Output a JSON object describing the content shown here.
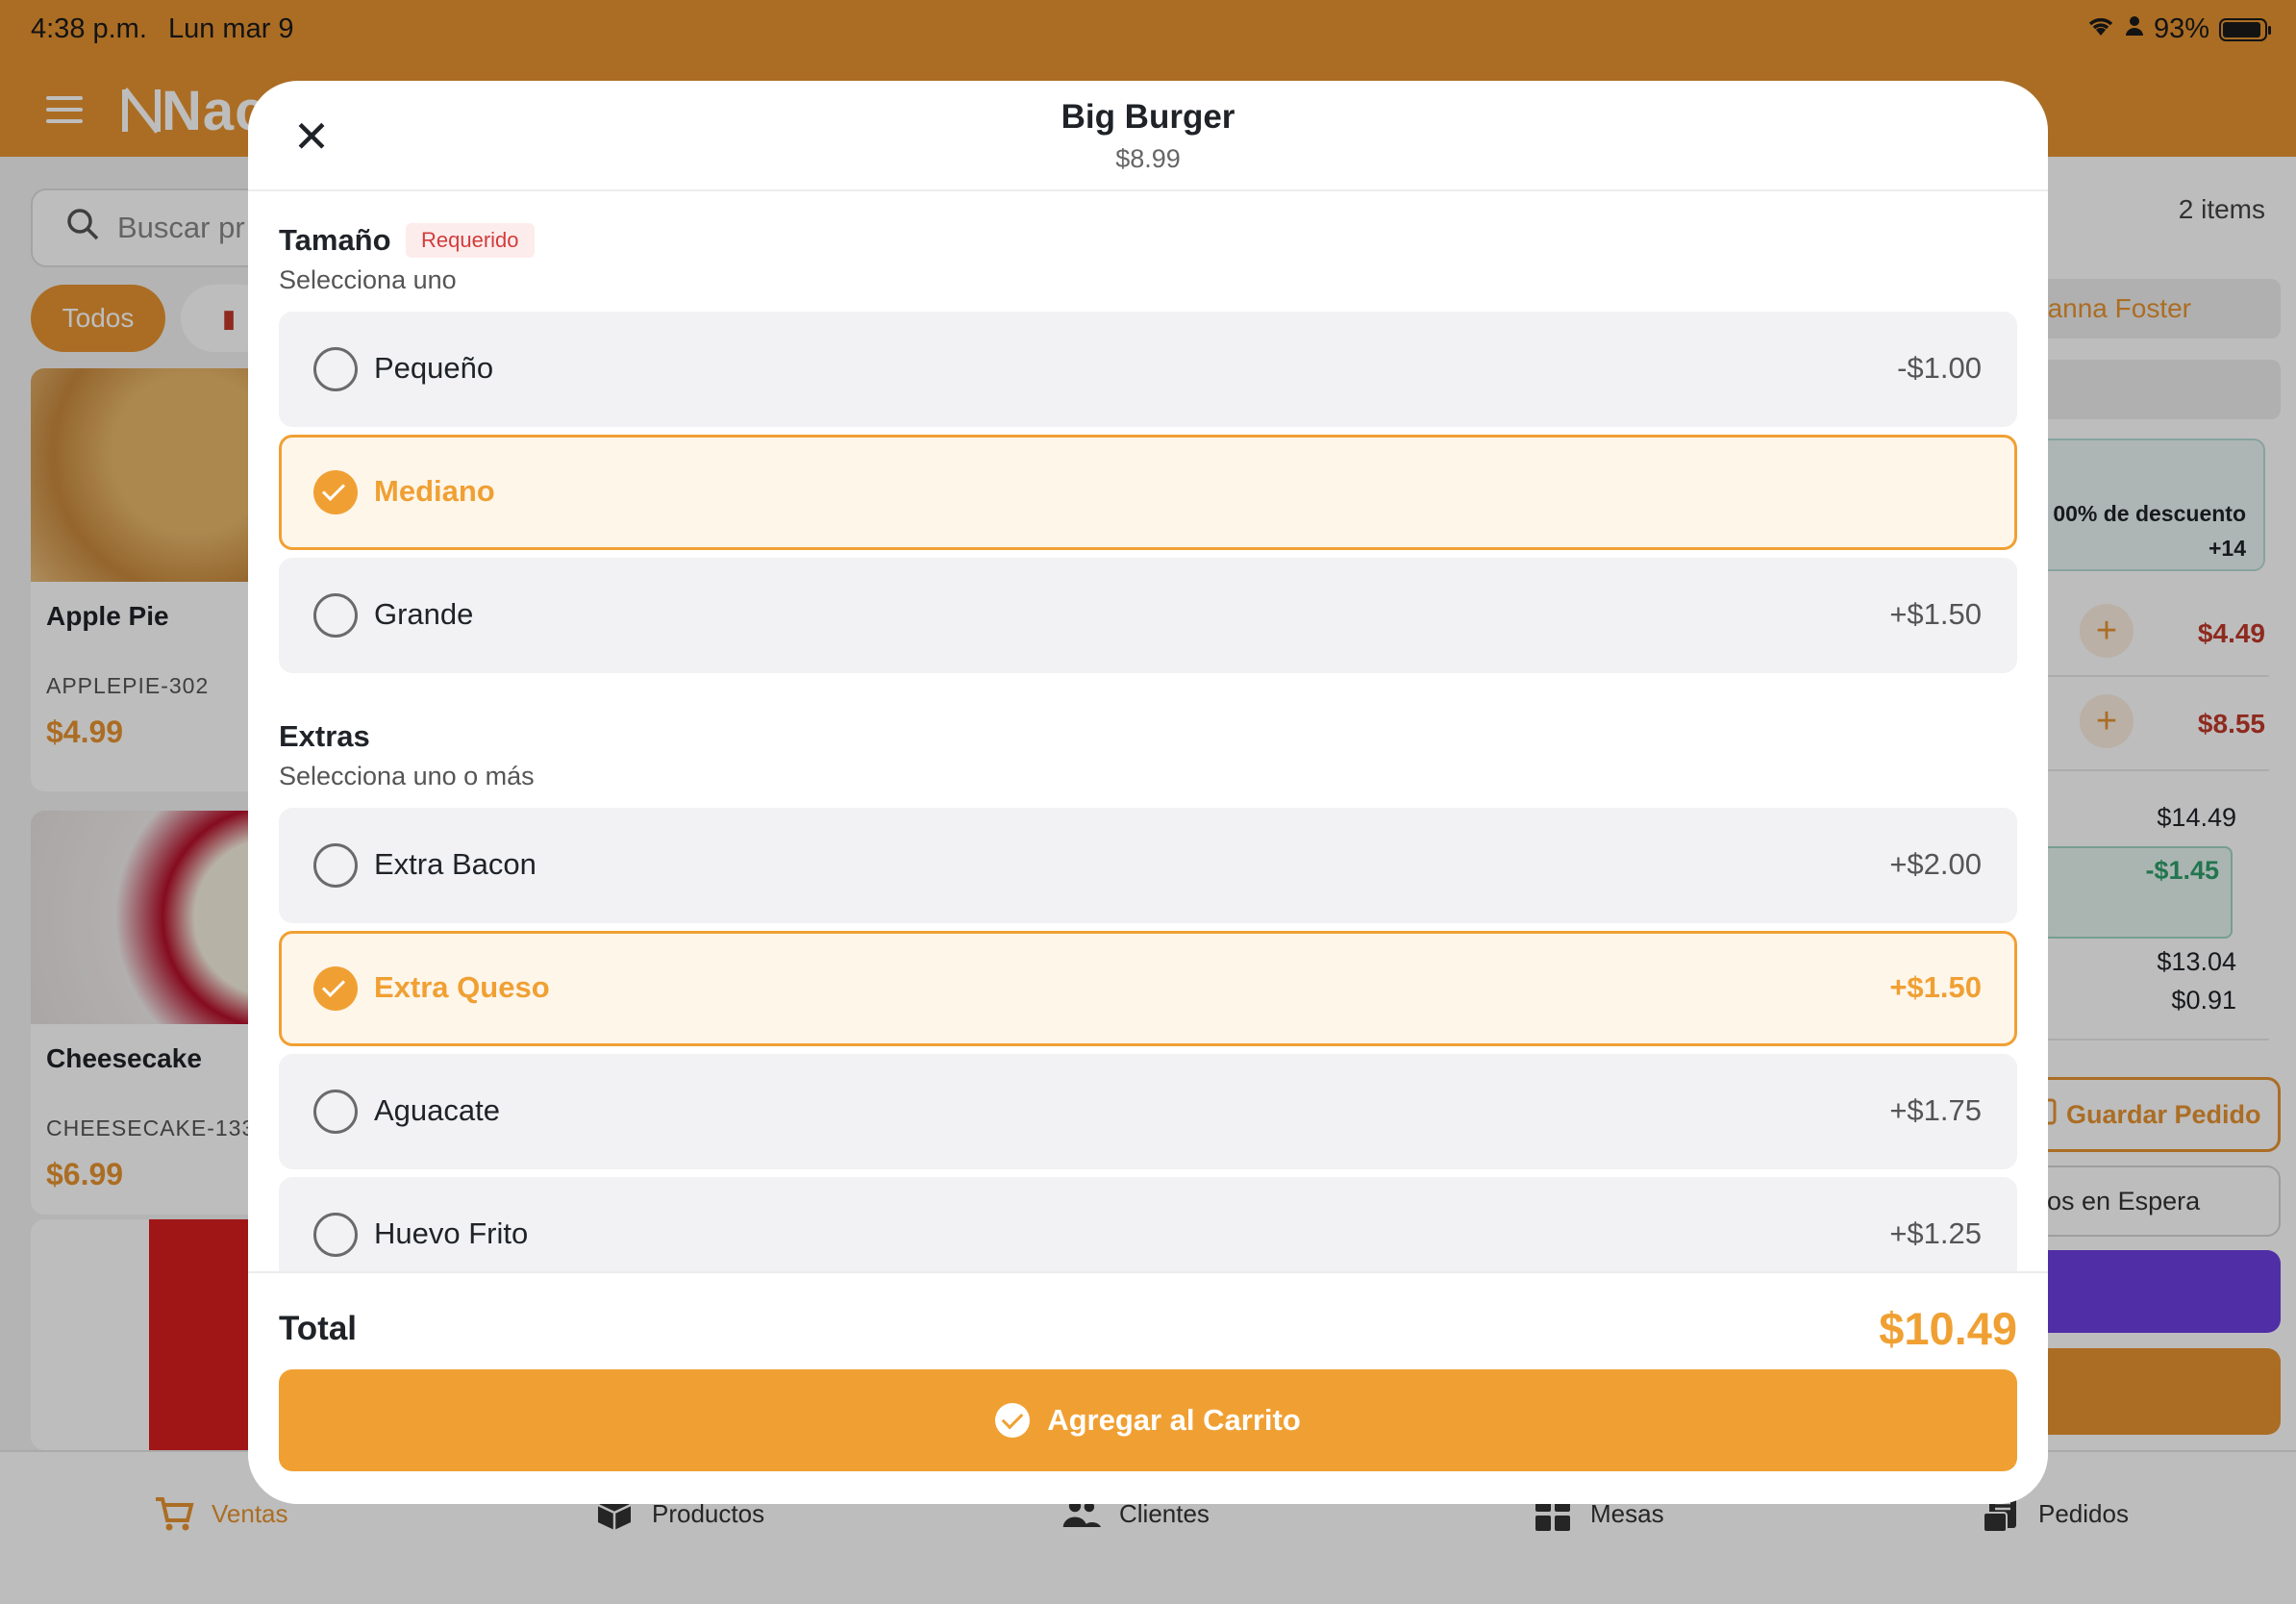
{
  "status_bar": {
    "time": "4:38 p.m.",
    "date": "Lun mar 9",
    "battery": "93%"
  },
  "header": {
    "logo_text": "Nac"
  },
  "search": {
    "placeholder": "Buscar pr"
  },
  "categories": {
    "all_label": "Todos"
  },
  "products": [
    {
      "name": "Apple Pie",
      "sku": "APPLEPIE-302",
      "price": "$4.99"
    },
    {
      "name": "Cheesecake",
      "sku": "CHEESECAKE-133",
      "price": "$6.99"
    }
  ],
  "cart": {
    "count": "2 items",
    "customer": "hanna Foster",
    "promo_line1": "00% de descuento",
    "promo_line2": "+14",
    "lines": [
      {
        "price": "$4.49"
      },
      {
        "price": "$8.55"
      }
    ],
    "subtotal": "$14.49",
    "discount": "-$1.45",
    "net": "$13.04",
    "tax": "$0.91",
    "save_label": "Guardar Pedido",
    "hold_label": "idos en Espera"
  },
  "tabs": [
    {
      "label": "Ventas",
      "icon": "cart-icon"
    },
    {
      "label": "Productos",
      "icon": "box-icon"
    },
    {
      "label": "Clientes",
      "icon": "users-icon"
    },
    {
      "label": "Mesas",
      "icon": "grid-icon"
    },
    {
      "label": "Pedidos",
      "icon": "receipt-icon"
    }
  ],
  "modal": {
    "title": "Big Burger",
    "price": "$8.99",
    "size_section": {
      "title": "Tamaño",
      "badge": "Requerido",
      "hint": "Selecciona uno",
      "options": [
        {
          "label": "Pequeño",
          "price": "-$1.00",
          "selected": false
        },
        {
          "label": "Mediano",
          "price": "",
          "selected": true
        },
        {
          "label": "Grande",
          "price": "+$1.50",
          "selected": false
        }
      ]
    },
    "extras_section": {
      "title": "Extras",
      "hint": "Selecciona uno o más",
      "options": [
        {
          "label": "Extra Bacon",
          "price": "+$2.00",
          "selected": false
        },
        {
          "label": "Extra Queso",
          "price": "+$1.50",
          "selected": true
        },
        {
          "label": "Aguacate",
          "price": "+$1.75",
          "selected": false
        },
        {
          "label": "Huevo Frito",
          "price": "+$1.25",
          "selected": false
        }
      ]
    },
    "total_label": "Total",
    "total_value": "$10.49",
    "add_button": "Agregar al Carrito"
  },
  "colors": {
    "accent": "#f0a033",
    "header": "#e79431",
    "required": "#d23c3c",
    "discount": "#2e9e6b",
    "purple": "#6d3fe0"
  }
}
